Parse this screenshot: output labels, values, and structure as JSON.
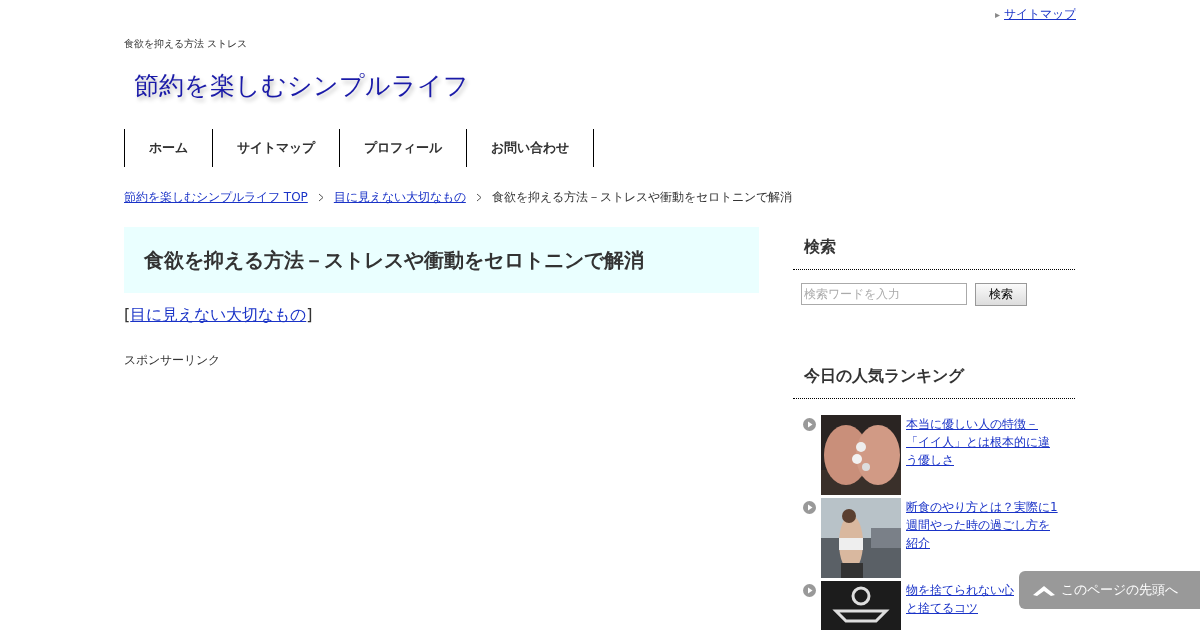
{
  "top_link": {
    "marker": "▸",
    "label": "サイトマップ"
  },
  "tagline": "食欲を抑える方法 ストレス",
  "site_title": "節約を楽しむシンプルライフ",
  "nav": [
    {
      "label": "ホーム"
    },
    {
      "label": "サイトマップ"
    },
    {
      "label": "プロフィール"
    },
    {
      "label": "お問い合わせ"
    }
  ],
  "breadcrumb": [
    {
      "label": "節約を楽しむシンプルライフ TOP",
      "link": true
    },
    {
      "label": "目に見えない大切なもの",
      "link": true
    },
    {
      "label": "食欲を抑える方法－ストレスや衝動をセロトニンで解消",
      "link": false
    }
  ],
  "article": {
    "title": "食欲を抑える方法－ストレスや衝動をセロトニンで解消",
    "category_open": "[",
    "category": "目に見えない大切なもの",
    "category_close": "]",
    "sponsor": "スポンサーリンク"
  },
  "sidebar": {
    "search": {
      "heading": "検索",
      "placeholder": "検索ワードを入力",
      "button": "検索"
    },
    "ranking": {
      "heading": "今日の人気ランキング",
      "items": [
        {
          "lines": [
            "本当に優しい人の特徴－",
            "「イイ人」とは根本的に違",
            "う優しさ"
          ],
          "picture": {
            "kind": "picture"
          }
        },
        {
          "lines": [
            "断食のやり方とは？実際に1",
            "週間やった時の過ごし方を",
            "紹介"
          ],
          "picture": {
            "kind": "picture"
          }
        },
        {
          "lines": [
            "物を捨てられない心",
            "と捨てるコツ"
          ],
          "picture": {
            "kind": "picture"
          }
        }
      ]
    }
  },
  "back_to_top": "このページの先頭へ"
}
